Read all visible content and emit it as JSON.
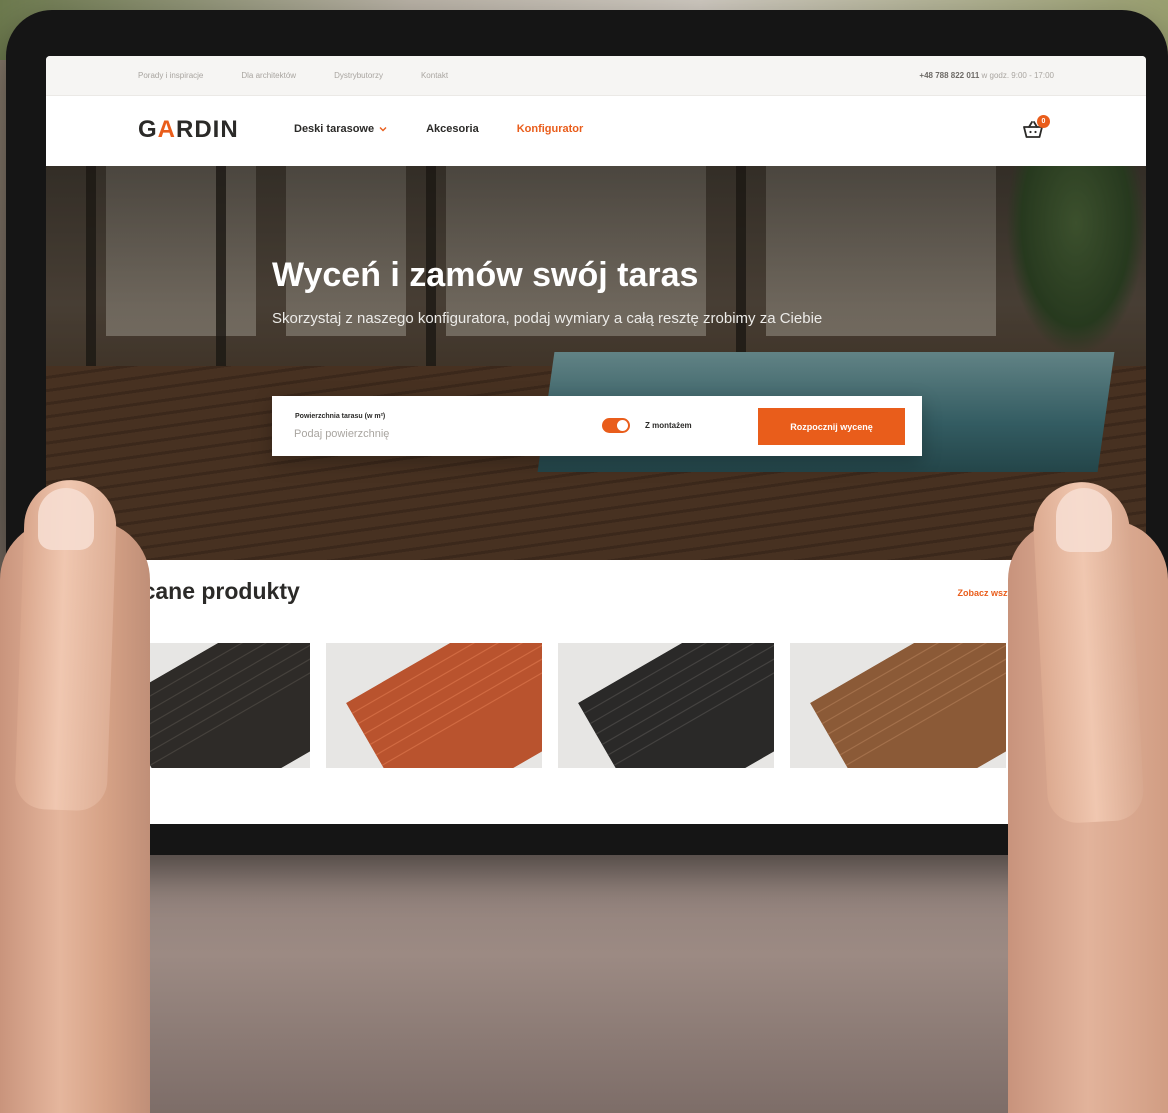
{
  "topbar": {
    "links": [
      "Porady i inspiracje",
      "Dla architektów",
      "Dystrybutorzy",
      "Kontakt"
    ],
    "phone": "+48 788 822 011",
    "hours": "w godz. 9:00 - 17:00"
  },
  "navbar": {
    "logo_text": "GARDIN",
    "items": [
      "Deski tarasowe",
      "Akcesoria",
      "Konfigurator"
    ],
    "active_item": "Konfigurator",
    "cart_count": "0"
  },
  "hero": {
    "title": "Wyceń i zamów swój taras",
    "subtitle": "Skorzystaj z naszego konfiguratora, podaj wymiary a całą resztę zrobimy za Ciebie"
  },
  "quote_form": {
    "label": "Powierzchnia tarasu (w m²)",
    "placeholder": "Podaj powierzchnię",
    "toggle_label": "Z montażem",
    "toggle_on": true,
    "button_label": "Rozpocznij wycenę"
  },
  "products": {
    "title": "Polecane produkty",
    "see_all": "Zobacz wszystkie produkty",
    "cards": [
      {
        "color": "#2e2b28"
      },
      {
        "color": "#b9532e"
      },
      {
        "color": "#2a2928"
      },
      {
        "color": "#8b5a37"
      }
    ]
  },
  "colors": {
    "accent": "#e95d1b",
    "text_dark": "#2b2a28",
    "muted": "#a9a5a0"
  },
  "icons": [
    "chevron-down-icon",
    "cart-icon"
  ]
}
